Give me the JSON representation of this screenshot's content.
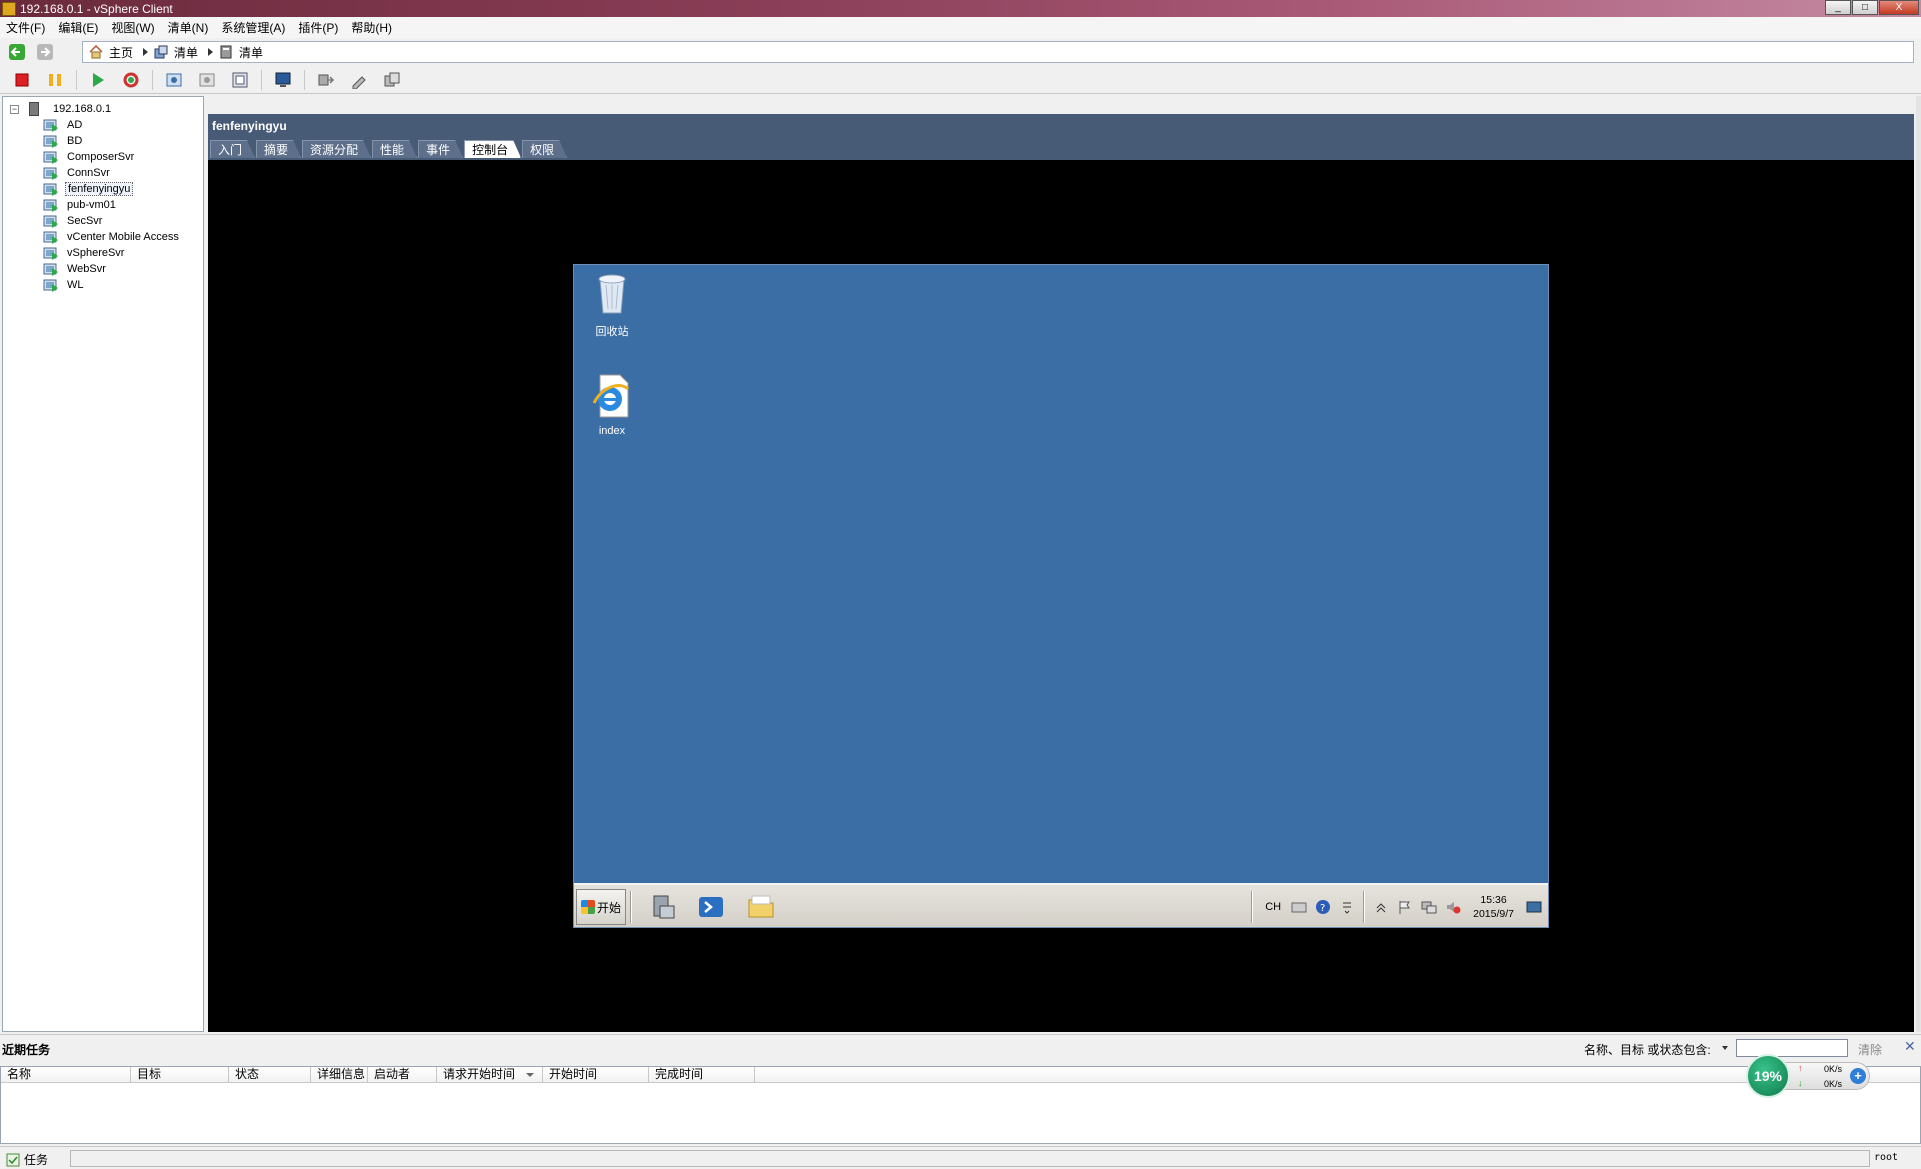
{
  "window": {
    "title": "192.168.0.1 - vSphere Client",
    "buttons": [
      "_",
      "□",
      "X"
    ]
  },
  "menu": [
    "文件(F)",
    "编辑(E)",
    "视图(W)",
    "清单(N)",
    "系统管理(A)",
    "插件(P)",
    "帮助(H)"
  ],
  "breadcrumb": [
    "主页",
    "清单",
    "清单"
  ],
  "tree": {
    "host": "192.168.0.1",
    "expander": "−",
    "vms": [
      "AD",
      "BD",
      "ComposerSvr",
      "ConnSvr",
      "fenfenyingyu",
      "pub-vm01",
      "SecSvr",
      "vCenter Mobile Access",
      "vSphereSvr",
      "WebSvr",
      "WL"
    ],
    "selected_index": 4
  },
  "vm_panel": {
    "name": "fenfenyingyu",
    "tabs": [
      "入门",
      "摘要",
      "资源分配",
      "性能",
      "事件",
      "控制台",
      "权限"
    ],
    "active_tab_index": 5
  },
  "guest": {
    "icons": [
      {
        "label": "回收站",
        "icon": "recycle-bin-icon"
      },
      {
        "label": "index",
        "icon": "ie-file-icon"
      }
    ],
    "start_label": "开始",
    "ime": "CH",
    "clock_time": "15:36",
    "clock_date": "2015/9/7"
  },
  "recent_tasks": {
    "title": "近期任务",
    "filter_label": "名称、目标 或状态包含:",
    "filter_value": "",
    "clear_label": "清除",
    "close_label": "✕",
    "columns": [
      "名称",
      "目标",
      "状态",
      "详细信息",
      "启动者",
      "请求开始时间",
      "开始时间",
      "完成时间"
    ]
  },
  "statusbar": {
    "tasks_label": "任务",
    "user": "root"
  },
  "net_widget": {
    "percent": "19%",
    "up_rate": "0K/s",
    "down_rate": "0K/s",
    "up_arrow": "↑",
    "down_arrow": "↓",
    "plus": "+"
  },
  "colors": {
    "panel_header": "#475a76",
    "guest_desktop": "#3b6ea5",
    "console_bg": "#000000"
  }
}
